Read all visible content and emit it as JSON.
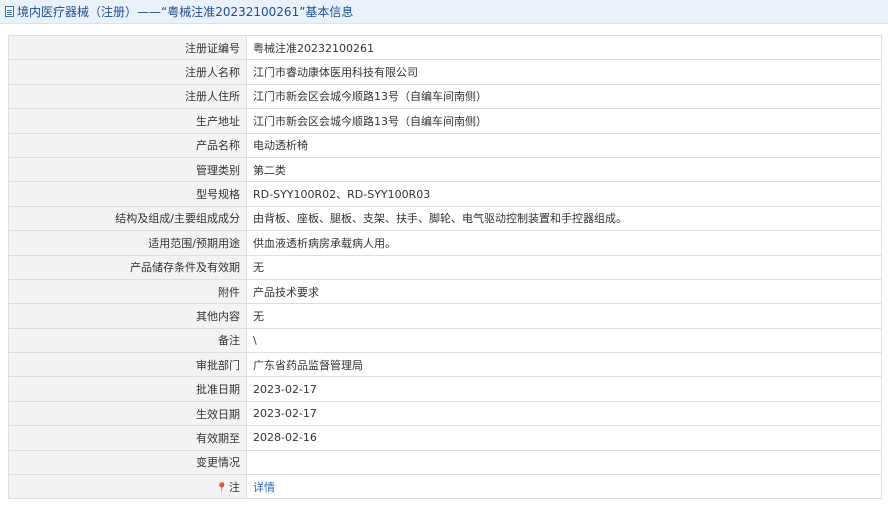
{
  "header": {
    "title": "境内医疗器械（注册）——“粤械注准20232100261”基本信息"
  },
  "rows": [
    {
      "label": "注册证编号",
      "value": "粤械注准20232100261"
    },
    {
      "label": "注册人名称",
      "value": "江门市睿动康体医用科技有限公司"
    },
    {
      "label": "注册人住所",
      "value": "江门市新会区会城今顺路13号（自编车间南侧）"
    },
    {
      "label": "生产地址",
      "value": "江门市新会区会城今顺路13号（自编车间南侧）"
    },
    {
      "label": "产品名称",
      "value": "电动透析椅"
    },
    {
      "label": "管理类别",
      "value": "第二类"
    },
    {
      "label": "型号规格",
      "value": "RD-SYY100R02、RD-SYY100R03"
    },
    {
      "label": "结构及组成/主要组成成分",
      "value": "由背板、座板、腿板、支架、扶手、脚轮、电气驱动控制装置和手控器组成。"
    },
    {
      "label": "适用范围/预期用途",
      "value": "供血液透析病房承载病人用。"
    },
    {
      "label": "产品储存条件及有效期",
      "value": "无"
    },
    {
      "label": "附件",
      "value": "产品技术要求"
    },
    {
      "label": "其他内容",
      "value": "无"
    },
    {
      "label": "备注",
      "value": "\\"
    },
    {
      "label": "审批部门",
      "value": "广东省药品监督管理局"
    },
    {
      "label": "批准日期",
      "value": "2023-02-17"
    },
    {
      "label": "生效日期",
      "value": "2023-02-17"
    },
    {
      "label": "有效期至",
      "value": "2028-02-16"
    },
    {
      "label": "变更情况",
      "value": ""
    }
  ],
  "note_row": {
    "label": "注",
    "icon": "pin-icon",
    "link_text": "详情"
  },
  "colors": {
    "header_bg": "#e9f1f9",
    "header_text": "#1d4f91",
    "label_bg": "#f3f3f3",
    "link": "#2a62b8"
  }
}
